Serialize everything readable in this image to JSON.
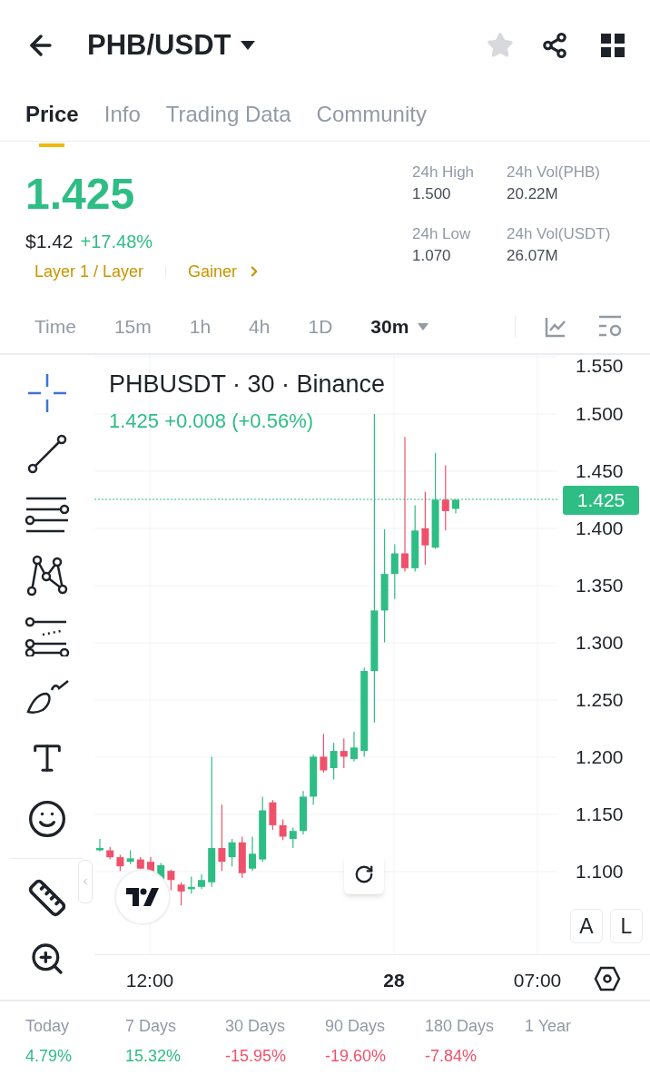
{
  "header": {
    "pair": "PHB/USDT",
    "favorite": false
  },
  "tabs": [
    {
      "label": "Price",
      "selected": true
    },
    {
      "label": "Info",
      "selected": false
    },
    {
      "label": "Trading Data",
      "selected": false
    },
    {
      "label": "Community",
      "selected": false
    }
  ],
  "price": {
    "last": "1.425",
    "fiat": "$1.42",
    "change": "+17.48%",
    "tags": [
      "Layer 1 / Layer",
      "Gainer"
    ]
  },
  "stats": [
    {
      "label": "24h High",
      "value": "1.500"
    },
    {
      "label": "24h Vol(PHB)",
      "value": "20.22M"
    },
    {
      "label": "24h Low",
      "value": "1.070"
    },
    {
      "label": "24h Vol(USDT)",
      "value": "26.07M"
    }
  ],
  "intervals": [
    {
      "label": "Time",
      "selected": false
    },
    {
      "label": "15m",
      "selected": false
    },
    {
      "label": "1h",
      "selected": false
    },
    {
      "label": "4h",
      "selected": false
    },
    {
      "label": "1D",
      "selected": false
    },
    {
      "label": "30m",
      "selected": true
    }
  ],
  "chart": {
    "title": "PHBUSDT · 30 · Binance",
    "quote": "1.425 +0.008 (+0.56%)",
    "price_ticks": [
      "1.550",
      "1.500",
      "1.450",
      "1.400",
      "1.350",
      "1.300",
      "1.250",
      "1.200",
      "1.150",
      "1.100"
    ],
    "current_price": "1.425",
    "scale_buttons": [
      "A",
      "L"
    ],
    "time_ticks": [
      {
        "label": "12:00",
        "kind": "time"
      },
      {
        "label": "28",
        "kind": "day"
      },
      {
        "label": "07:00",
        "kind": "time"
      }
    ]
  },
  "performance": [
    {
      "label": "Today",
      "value": "4.79%",
      "color": "#2ebd85"
    },
    {
      "label": "7 Days",
      "value": "15.32%",
      "color": "#2ebd85"
    },
    {
      "label": "30 Days",
      "value": "-15.95%",
      "color": "#f0516a"
    },
    {
      "label": "90 Days",
      "value": "-19.60%",
      "color": "#f0516a"
    },
    {
      "label": "180 Days",
      "value": "-7.84%",
      "color": "#f0516a"
    },
    {
      "label": "1 Year"
    }
  ]
}
